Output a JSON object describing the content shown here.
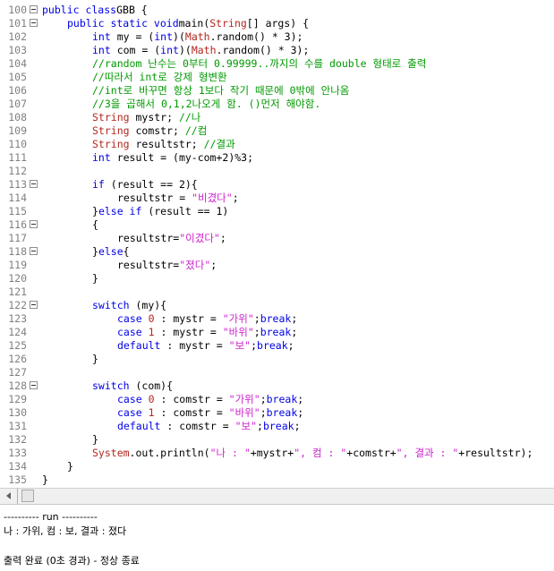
{
  "editor": {
    "lines": [
      {
        "n": "100",
        "fold": true,
        "ind": 0,
        "tokens": [
          [
            "kw",
            "public class"
          ],
          [
            "",
            "GBB {"
          ]
        ]
      },
      {
        "n": "101",
        "fold": true,
        "ind": 4,
        "tokens": [
          [
            "kw",
            "public static void"
          ],
          [
            "",
            "main("
          ],
          [
            "cls",
            "String"
          ],
          [
            "",
            "[] args) {"
          ]
        ]
      },
      {
        "n": "102",
        "fold": false,
        "ind": 8,
        "tokens": [
          [
            "kw",
            "int"
          ],
          [
            "",
            " my = ("
          ],
          [
            "kw",
            "int"
          ],
          [
            "",
            ")("
          ],
          [
            "cls",
            "Math"
          ],
          [
            "",
            ".random() * 3);"
          ]
        ]
      },
      {
        "n": "103",
        "fold": false,
        "ind": 8,
        "tokens": [
          [
            "kw",
            "int"
          ],
          [
            "",
            " com = ("
          ],
          [
            "kw",
            "int"
          ],
          [
            "",
            ")("
          ],
          [
            "cls",
            "Math"
          ],
          [
            "",
            ".random() * 3);"
          ]
        ]
      },
      {
        "n": "104",
        "fold": false,
        "ind": 8,
        "tokens": [
          [
            "com",
            "//random 난수는 0부터 0.99999..까지의 수를 double 형태로 출력"
          ]
        ]
      },
      {
        "n": "105",
        "fold": false,
        "ind": 8,
        "tokens": [
          [
            "com",
            "//따라서 int로 강제 형변환"
          ]
        ]
      },
      {
        "n": "106",
        "fold": false,
        "ind": 8,
        "tokens": [
          [
            "com",
            "//int로 바꾸면 항상 1보다 작기 때문에 0밖에 안나옴"
          ]
        ]
      },
      {
        "n": "107",
        "fold": false,
        "ind": 8,
        "tokens": [
          [
            "com",
            "//3을 곱해서 0,1,2나오게 함. ()먼저 해야함."
          ]
        ]
      },
      {
        "n": "108",
        "fold": false,
        "ind": 8,
        "tokens": [
          [
            "cls",
            "String"
          ],
          [
            "",
            " mystr; "
          ],
          [
            "com",
            "//나"
          ]
        ]
      },
      {
        "n": "109",
        "fold": false,
        "ind": 8,
        "tokens": [
          [
            "cls",
            "String"
          ],
          [
            "",
            " comstr; "
          ],
          [
            "com",
            "//컴"
          ]
        ]
      },
      {
        "n": "110",
        "fold": false,
        "ind": 8,
        "tokens": [
          [
            "cls",
            "String"
          ],
          [
            "",
            " resultstr; "
          ],
          [
            "com",
            "//결과"
          ]
        ]
      },
      {
        "n": "111",
        "fold": false,
        "ind": 8,
        "tokens": [
          [
            "kw",
            "int"
          ],
          [
            "",
            " result = (my-com+2)%3;"
          ]
        ]
      },
      {
        "n": "112",
        "fold": false,
        "ind": 0,
        "tokens": []
      },
      {
        "n": "113",
        "fold": true,
        "ind": 8,
        "tokens": [
          [
            "kw",
            "if"
          ],
          [
            "",
            " (result == 2){"
          ]
        ]
      },
      {
        "n": "114",
        "fold": false,
        "ind": 12,
        "tokens": [
          [
            "",
            "resultstr = "
          ],
          [
            "str",
            "\"비겼다\""
          ],
          [
            "",
            ";"
          ]
        ]
      },
      {
        "n": "115",
        "fold": false,
        "ind": 8,
        "tokens": [
          [
            "",
            "}"
          ],
          [
            "kw",
            "else if"
          ],
          [
            "",
            " (result == 1)"
          ]
        ]
      },
      {
        "n": "116",
        "fold": true,
        "ind": 8,
        "tokens": [
          [
            "",
            "{"
          ]
        ]
      },
      {
        "n": "117",
        "fold": false,
        "ind": 12,
        "tokens": [
          [
            "",
            "resultstr="
          ],
          [
            "str",
            "\"이겼다\""
          ],
          [
            "",
            ";"
          ]
        ]
      },
      {
        "n": "118",
        "fold": true,
        "ind": 8,
        "tokens": [
          [
            "",
            "}"
          ],
          [
            "kw",
            "else"
          ],
          [
            "",
            "{"
          ]
        ]
      },
      {
        "n": "119",
        "fold": false,
        "ind": 12,
        "tokens": [
          [
            "",
            "resultstr="
          ],
          [
            "str",
            "\"졌다\""
          ],
          [
            "",
            ";"
          ]
        ]
      },
      {
        "n": "120",
        "fold": false,
        "ind": 8,
        "tokens": [
          [
            "",
            "}"
          ]
        ]
      },
      {
        "n": "121",
        "fold": false,
        "ind": 0,
        "tokens": []
      },
      {
        "n": "122",
        "fold": true,
        "ind": 8,
        "tokens": [
          [
            "kw",
            "switch"
          ],
          [
            "",
            " (my){"
          ]
        ]
      },
      {
        "n": "123",
        "fold": false,
        "ind": 12,
        "tokens": [
          [
            "kw",
            "case"
          ],
          [
            "",
            " "
          ],
          [
            "num",
            "0"
          ],
          [
            "",
            " : mystr = "
          ],
          [
            "str",
            "\"가위\""
          ],
          [
            "",
            ";"
          ],
          [
            "kw",
            "break"
          ],
          [
            "",
            ";"
          ]
        ]
      },
      {
        "n": "124",
        "fold": false,
        "ind": 12,
        "tokens": [
          [
            "kw",
            "case"
          ],
          [
            "",
            " "
          ],
          [
            "num",
            "1"
          ],
          [
            "",
            " : mystr = "
          ],
          [
            "str",
            "\"바위\""
          ],
          [
            "",
            ";"
          ],
          [
            "kw",
            "break"
          ],
          [
            "",
            ";"
          ]
        ]
      },
      {
        "n": "125",
        "fold": false,
        "ind": 12,
        "tokens": [
          [
            "kw",
            "default"
          ],
          [
            "",
            " : mystr = "
          ],
          [
            "str",
            "\"보\""
          ],
          [
            "",
            ";"
          ],
          [
            "kw",
            "break"
          ],
          [
            "",
            ";"
          ]
        ]
      },
      {
        "n": "126",
        "fold": false,
        "ind": 8,
        "tokens": [
          [
            "",
            "}"
          ]
        ]
      },
      {
        "n": "127",
        "fold": false,
        "ind": 0,
        "tokens": []
      },
      {
        "n": "128",
        "fold": true,
        "ind": 8,
        "tokens": [
          [
            "kw",
            "switch"
          ],
          [
            "",
            " (com){"
          ]
        ]
      },
      {
        "n": "129",
        "fold": false,
        "ind": 12,
        "tokens": [
          [
            "kw",
            "case"
          ],
          [
            "",
            " "
          ],
          [
            "num",
            "0"
          ],
          [
            "",
            " : comstr = "
          ],
          [
            "str",
            "\"가위\""
          ],
          [
            "",
            ";"
          ],
          [
            "kw",
            "break"
          ],
          [
            "",
            ";"
          ]
        ]
      },
      {
        "n": "130",
        "fold": false,
        "ind": 12,
        "tokens": [
          [
            "kw",
            "case"
          ],
          [
            "",
            " "
          ],
          [
            "num",
            "1"
          ],
          [
            "",
            " : comstr = "
          ],
          [
            "str",
            "\"바위\""
          ],
          [
            "",
            ";"
          ],
          [
            "kw",
            "break"
          ],
          [
            "",
            ";"
          ]
        ]
      },
      {
        "n": "131",
        "fold": false,
        "ind": 12,
        "tokens": [
          [
            "kw",
            "default"
          ],
          [
            "",
            " : comstr = "
          ],
          [
            "str",
            "\"보\""
          ],
          [
            "",
            ";"
          ],
          [
            "kw",
            "break"
          ],
          [
            "",
            ";"
          ]
        ]
      },
      {
        "n": "132",
        "fold": false,
        "ind": 8,
        "tokens": [
          [
            "",
            "}"
          ]
        ]
      },
      {
        "n": "133",
        "fold": false,
        "ind": 8,
        "tokens": [
          [
            "cls",
            "System"
          ],
          [
            "",
            ".out.println("
          ],
          [
            "str",
            "\"나 : \""
          ],
          [
            "",
            "+mystr+"
          ],
          [
            "str",
            "\", 컴 : \""
          ],
          [
            "",
            "+comstr+"
          ],
          [
            "str",
            "\", 결과 : \""
          ],
          [
            "",
            "+resultstr);"
          ]
        ]
      },
      {
        "n": "134",
        "fold": false,
        "ind": 4,
        "tokens": [
          [
            "",
            "}"
          ]
        ]
      },
      {
        "n": "135",
        "fold": false,
        "ind": 0,
        "tokens": [
          [
            "",
            "}"
          ]
        ]
      }
    ]
  },
  "output": {
    "lines": [
      "---------- run ----------",
      "나 : 가위, 컴 : 보, 결과 : 졌다",
      "",
      "출력 완료 (0초 경과) - 정상 종료"
    ]
  },
  "icons": {
    "fold": "collapse-box-icon",
    "scroll_left": "arrow-left-icon"
  }
}
